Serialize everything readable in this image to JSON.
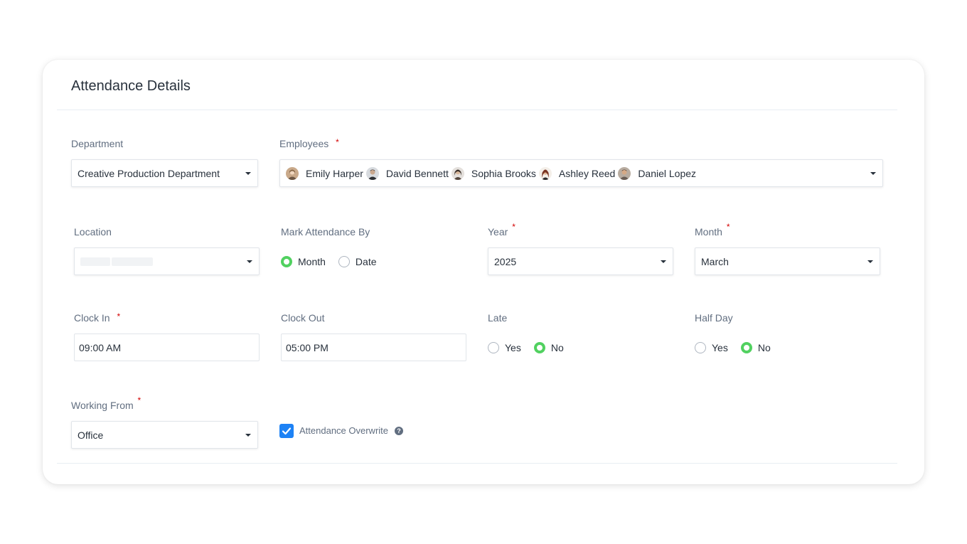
{
  "title": "Attendance Details",
  "department": {
    "label": "Department",
    "value": "Creative Production Department"
  },
  "employees": {
    "label": "Employees",
    "required_mark": "*",
    "selected": [
      {
        "name": "Emily Harper",
        "avatar_color": "#c9a98a"
      },
      {
        "name": "David Bennett",
        "avatar_color": "#4a4f55"
      },
      {
        "name": "Sophia Brooks",
        "avatar_color": "#7a6a5e"
      },
      {
        "name": "Ashley Reed",
        "avatar_color": "#8a4a34"
      },
      {
        "name": "Daniel Lopez",
        "avatar_color": "#9c8878"
      }
    ]
  },
  "location": {
    "label": "Location",
    "value": ""
  },
  "mark_by": {
    "label": "Mark Attendance By",
    "options": [
      "Month",
      "Date"
    ],
    "selected": "Month"
  },
  "year": {
    "label": "Year",
    "required_mark": "*",
    "value": "2025"
  },
  "month": {
    "label": "Month",
    "required_mark": "*",
    "value": "March"
  },
  "clock_in": {
    "label": "Clock In",
    "required_mark": "*",
    "value": "09:00 AM"
  },
  "clock_out": {
    "label": "Clock Out",
    "value": "05:00 PM"
  },
  "late": {
    "label": "Late",
    "options": [
      "Yes",
      "No"
    ],
    "selected": "No"
  },
  "half_day": {
    "label": "Half Day",
    "options": [
      "Yes",
      "No"
    ],
    "selected": "No"
  },
  "working_from": {
    "label": "Working From",
    "required_mark": "*",
    "value": "Office"
  },
  "overwrite": {
    "label": "Attendance Overwrite",
    "checked": true,
    "help_icon": "question-circle-icon"
  },
  "colors": {
    "accent": "#1d82f5",
    "radio_on": "#51d160",
    "required": "#d30000"
  }
}
